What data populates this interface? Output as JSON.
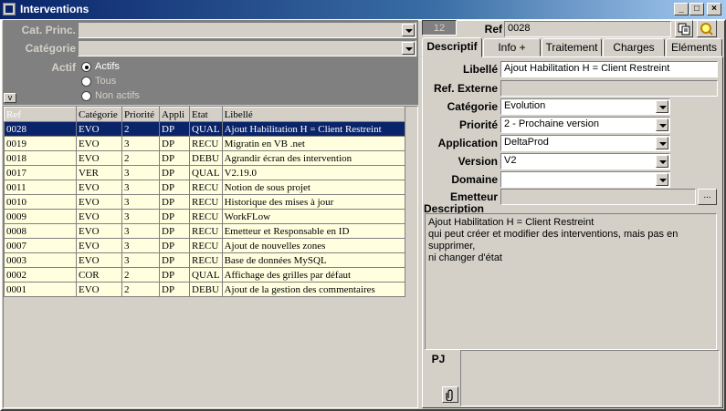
{
  "window": {
    "title": "Interventions",
    "buttons": [
      "_",
      "□",
      "×"
    ]
  },
  "filters": {
    "cat_princ_label": "Cat. Princ.",
    "categorie_label": "Catégorie",
    "cat_princ_value": "",
    "categorie_value": "",
    "actif_label": "Actif",
    "options": [
      "Actifs",
      "Tous",
      "Non actifs"
    ],
    "selected": "Actifs",
    "v_button": "v"
  },
  "table": {
    "columns": [
      "Ref",
      "Catégorie",
      "Priorité",
      "Appli",
      "Etat",
      "Libellé"
    ],
    "rows": [
      [
        "0028",
        "EVO",
        "2",
        "DP",
        "QUAL",
        "Ajout Habilitation H = Client Restreint"
      ],
      [
        "0019",
        "EVO",
        "3",
        "DP",
        "RECU",
        "Migratin en VB .net"
      ],
      [
        "0018",
        "EVO",
        "2",
        "DP",
        "DEBU",
        "Agrandir écran des intervention"
      ],
      [
        "0017",
        "VER",
        "3",
        "DP",
        "QUAL",
        "V2.19.0"
      ],
      [
        "0011",
        "EVO",
        "3",
        "DP",
        "RECU",
        "Notion de sous projet"
      ],
      [
        "0010",
        "EVO",
        "3",
        "DP",
        "RECU",
        "Historique des mises à jour"
      ],
      [
        "0009",
        "EVO",
        "3",
        "DP",
        "RECU",
        "WorkFLow"
      ],
      [
        "0008",
        "EVO",
        "3",
        "DP",
        "RECU",
        "Emetteur et Responsable en ID"
      ],
      [
        "0007",
        "EVO",
        "3",
        "DP",
        "RECU",
        "Ajout de nouvelles zones"
      ],
      [
        "0003",
        "EVO",
        "3",
        "DP",
        "RECU",
        "Base de données MySQL"
      ],
      [
        "0002",
        "COR",
        "2",
        "DP",
        "QUAL",
        "Affichage des grilles par défaut"
      ],
      [
        "0001",
        "EVO",
        "2",
        "DP",
        "DEBU",
        "Ajout de la gestion des commentaires"
      ]
    ],
    "selected_row": 0
  },
  "header": {
    "count": "12",
    "ref_label": "Ref",
    "ref_value": "0028"
  },
  "tabs": [
    "Descriptif",
    "Info +",
    "Traitement",
    "Charges",
    "Eléments"
  ],
  "active_tab": "Descriptif",
  "form": {
    "libelle_label": "Libellé",
    "libelle_value": "Ajout Habilitation H = Client Restreint",
    "ref_externe_label": "Ref. Externe",
    "ref_externe_value": "",
    "categorie_label": "Catégorie",
    "categorie_value": "Evolution",
    "priorite_label": "Priorité",
    "priorite_value": "2 - Prochaine version",
    "application_label": "Application",
    "application_value": "DeltaProd",
    "version_label": "Version",
    "version_value": "V2",
    "domaine_label": "Domaine",
    "domaine_value": "",
    "emetteur_label": "Emetteur",
    "emetteur_value": "",
    "emetteur_button": "...",
    "description_label": "Description",
    "description_lines": [
      "Ajout Habilitation H = Client Restreint",
      "qui peut créer et modifier des interventions, mais pas en supprimer,",
      "ni changer d'état"
    ],
    "pj_label": "PJ"
  },
  "icons": {
    "copy": "copy-icon",
    "search": "search-icon",
    "attach": "paperclip-icon"
  }
}
